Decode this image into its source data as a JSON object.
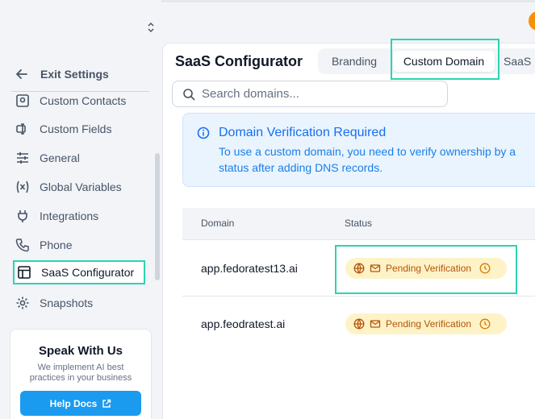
{
  "sidebar": {
    "exit_label": "Exit Settings",
    "items": [
      {
        "label": "Custom Contacts",
        "icon": "contacts-icon"
      },
      {
        "label": "Custom Fields",
        "icon": "custom-fields-icon"
      },
      {
        "label": "General",
        "icon": "sliders-icon"
      },
      {
        "label": "Global Variables",
        "icon": "variable-icon"
      },
      {
        "label": "Integrations",
        "icon": "plug-icon"
      },
      {
        "label": "Phone",
        "icon": "phone-icon"
      },
      {
        "label": "SaaS Configurator",
        "icon": "layout-icon",
        "active": true
      },
      {
        "label": "Snapshots",
        "icon": "gear-icon"
      }
    ],
    "promo": {
      "title": "Speak With Us",
      "desc": "We implement AI best practices in your business",
      "button": "Help Docs"
    }
  },
  "header": {
    "title": "SaaS Configurator",
    "tabs": [
      {
        "label": "Branding"
      },
      {
        "label": "Custom Domain",
        "active": true
      },
      {
        "label": "SaaS"
      }
    ]
  },
  "search": {
    "placeholder": "Search domains..."
  },
  "alert": {
    "title": "Domain Verification Required",
    "line1": "To use a custom domain, you need to verify ownership by a",
    "line2": "status after adding DNS records."
  },
  "table": {
    "columns": [
      "Domain",
      "Status"
    ],
    "rows": [
      {
        "domain": "app.fedoratest13.ai",
        "status": "Pending Verification"
      },
      {
        "domain": "app.feodratest.ai",
        "status": "Pending Verification"
      }
    ]
  },
  "colors": {
    "accent": "#1a9bf0",
    "highlight": "#2bd4b0",
    "pending_bg": "#fef3c7",
    "pending_text": "#b45309",
    "alert_text": "#1570ef"
  }
}
